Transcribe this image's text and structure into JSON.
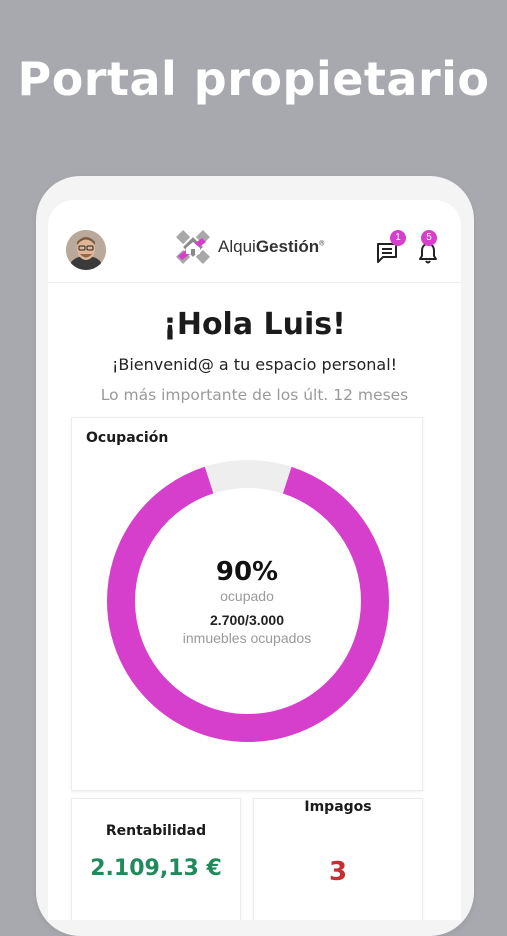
{
  "headline": "Portal propietario",
  "app": {
    "logo_light": "Alqui",
    "logo_bold": "Gestión",
    "logo_mark": "®",
    "messages_badge": "1",
    "notifications_badge": "5"
  },
  "greeting": "¡Hola Luis!",
  "welcome": "¡Bienvenid@ a tu espacio personal!",
  "subtitle": "Lo más importante de los últ. 12 meses",
  "occupancy": {
    "title": "Ocupación",
    "percent_text": "90%",
    "percent": 0.9,
    "percent_label": "ocupado",
    "count_text": "2.700/3.000",
    "count_label": "inmuebles ocupados",
    "ring_color": "#d63fcb",
    "track_color": "#eeeeee"
  },
  "rentabilidad": {
    "title": "Rentabilidad",
    "value": "2.109,13 €",
    "color": "#1f8a5b"
  },
  "impagos": {
    "title": "Impagos",
    "value": "3",
    "color": "#c62f2f"
  }
}
